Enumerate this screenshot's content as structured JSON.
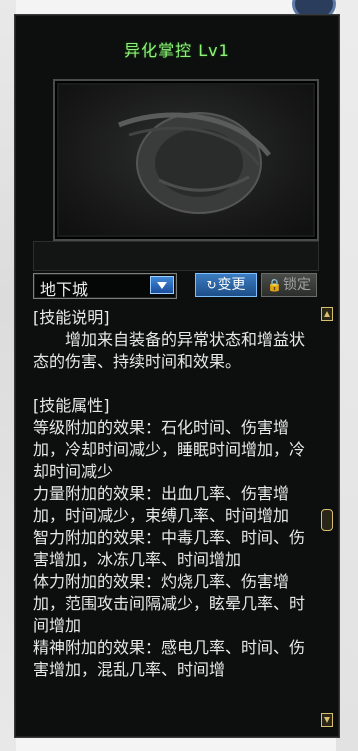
{
  "window": {
    "title": "异化掌控 Lv1"
  },
  "skill_art": {
    "icon": "skill-emblem-placeholder"
  },
  "controls": {
    "dropdown_value": "地下城",
    "change_label": "变更",
    "lock_label": "锁定",
    "change_icon": "refresh-icon",
    "lock_icon": "lock-icon"
  },
  "description": {
    "header_desc": "[技能说明]",
    "desc_text": "增加来自装备的异常状态和增益状态的伤害、持续时间和效果。",
    "header_attr": "[技能属性]",
    "level_effect": "等级附加的效果：石化时间、伤害增加，冷却时间减少，睡眠时间增加，冷却时间减少",
    "strength_effect": "力量附加的效果：出血几率、伤害增加，时间减少，束缚几率、时间增加",
    "intelligence_effect": "智力附加的效果：中毒几率、时间、伤害增加，冰冻几率、时间增加",
    "vitality_effect": "体力附加的效果：灼烧几率、伤害增加，范围攻击间隔减少，眩晕几率、时间增加",
    "spirit_effect": "精神附加的效果：感电几率、时间、伤害增加，混乱几率、时间增"
  },
  "colors": {
    "title": "#8ef27a",
    "panel_bg": "#0d0f0f",
    "text": "#e8e8e8",
    "accent_blue": "#3c7cc0",
    "scroll_gold": "#d8c070"
  }
}
